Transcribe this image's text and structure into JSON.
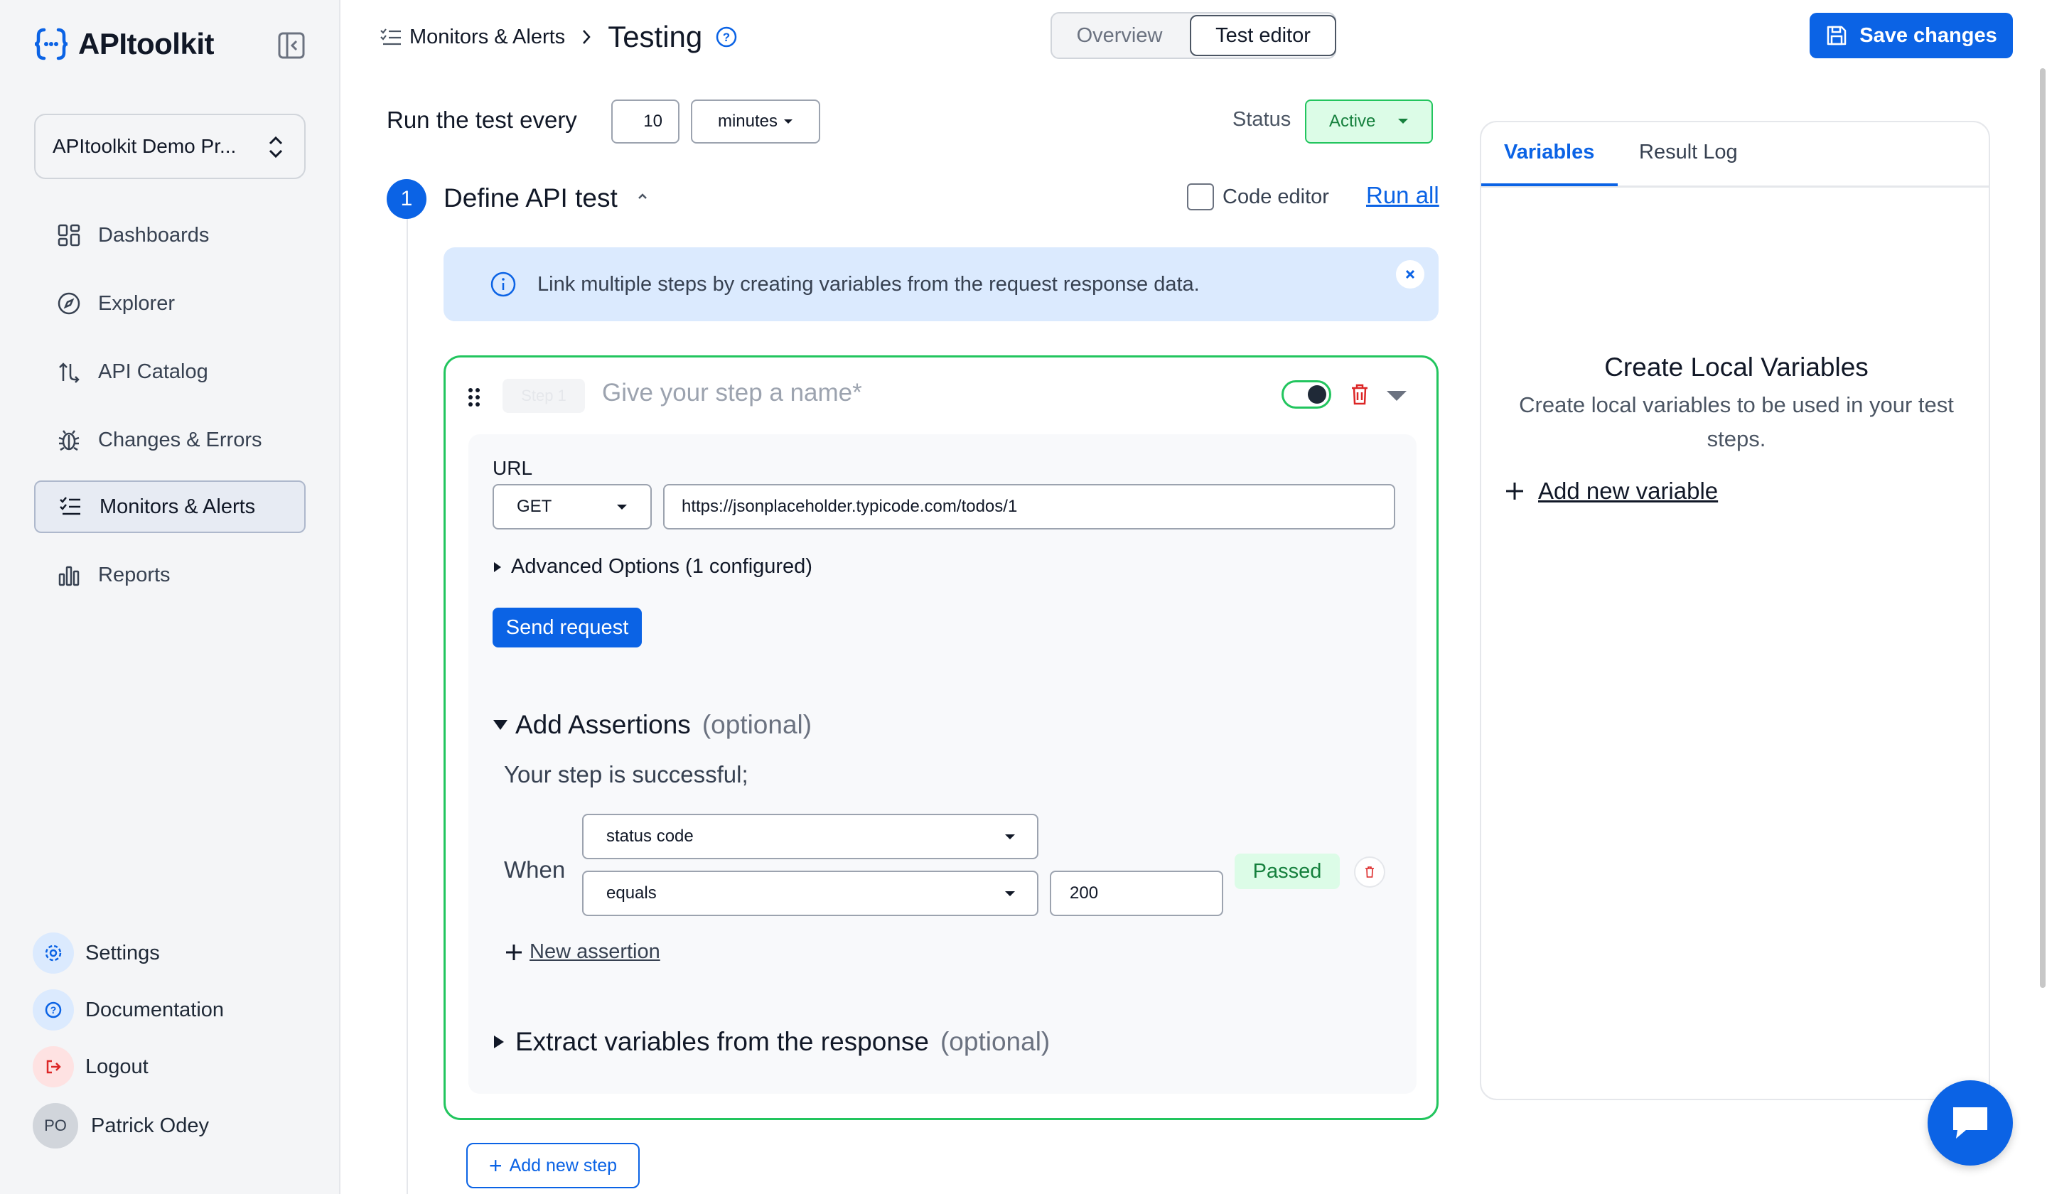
{
  "app": {
    "logo_text": "APItoolkit"
  },
  "sidebar": {
    "project": "APItoolkit Demo Pr...",
    "items": [
      {
        "label": "Dashboards",
        "icon": "dashboard-icon"
      },
      {
        "label": "Explorer",
        "icon": "compass-icon"
      },
      {
        "label": "API Catalog",
        "icon": "catalog-icon"
      },
      {
        "label": "Changes & Errors",
        "icon": "bug-icon"
      },
      {
        "label": "Monitors & Alerts",
        "icon": "checklist-icon",
        "active": true
      },
      {
        "label": "Reports",
        "icon": "bar-chart-icon"
      }
    ],
    "bottom": {
      "settings": "Settings",
      "documentation": "Documentation",
      "logout": "Logout",
      "user_initials": "PO",
      "user_name": "Patrick Odey"
    }
  },
  "header": {
    "breadcrumb_parent": "Monitors & Alerts",
    "title": "Testing",
    "tabs": {
      "overview": "Overview",
      "test_editor": "Test editor"
    },
    "save_label": "Save changes"
  },
  "schedule": {
    "label": "Run the test every",
    "interval": "10",
    "unit": "minutes",
    "status_label": "Status",
    "status": "Active"
  },
  "define": {
    "step_number": "1",
    "title": "Define API test",
    "code_editor_label": "Code editor",
    "run_all": "Run all",
    "info": "Link multiple steps by creating variables from the request response data."
  },
  "step": {
    "badge": "Step 1",
    "name_placeholder": "Give your step a name*",
    "url_label": "URL",
    "method": "GET",
    "url": "https://jsonplaceholder.typicode.com/todos/1",
    "advanced": "Advanced Options (1 configured)",
    "send": "Send request",
    "assertions_title": "Add Assertions",
    "optional": "(optional)",
    "success_text": "Your step is successful;",
    "when": "When",
    "assertion": {
      "field": "status code",
      "operator": "equals",
      "value": "200",
      "result": "Passed"
    },
    "new_assertion": "New assertion",
    "extract_title": "Extract variables from the response",
    "extract_optional": "(optional)"
  },
  "add_step": "Add new step",
  "right_panel": {
    "tabs": [
      "Variables",
      "Result Log"
    ],
    "title": "Create Local Variables",
    "description": "Create local variables to be used in your test steps.",
    "add_variable": "Add new variable"
  },
  "colors": {
    "accent": "#0b63e5",
    "success": "#22c55e",
    "danger": "#dc2626"
  }
}
